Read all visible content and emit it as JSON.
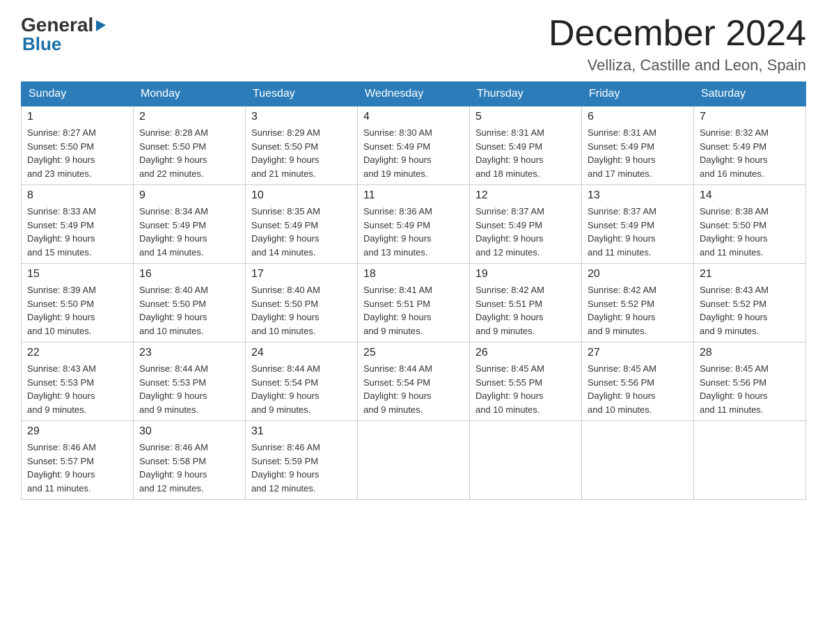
{
  "logo": {
    "general": "General",
    "blue": "Blue"
  },
  "title": "December 2024",
  "subtitle": "Velliza, Castille and Leon, Spain",
  "weekdays": [
    "Sunday",
    "Monday",
    "Tuesday",
    "Wednesday",
    "Thursday",
    "Friday",
    "Saturday"
  ],
  "weeks": [
    [
      {
        "day": "1",
        "sunrise": "8:27 AM",
        "sunset": "5:50 PM",
        "daylight": "9 hours and 23 minutes."
      },
      {
        "day": "2",
        "sunrise": "8:28 AM",
        "sunset": "5:50 PM",
        "daylight": "9 hours and 22 minutes."
      },
      {
        "day": "3",
        "sunrise": "8:29 AM",
        "sunset": "5:50 PM",
        "daylight": "9 hours and 21 minutes."
      },
      {
        "day": "4",
        "sunrise": "8:30 AM",
        "sunset": "5:49 PM",
        "daylight": "9 hours and 19 minutes."
      },
      {
        "day": "5",
        "sunrise": "8:31 AM",
        "sunset": "5:49 PM",
        "daylight": "9 hours and 18 minutes."
      },
      {
        "day": "6",
        "sunrise": "8:31 AM",
        "sunset": "5:49 PM",
        "daylight": "9 hours and 17 minutes."
      },
      {
        "day": "7",
        "sunrise": "8:32 AM",
        "sunset": "5:49 PM",
        "daylight": "9 hours and 16 minutes."
      }
    ],
    [
      {
        "day": "8",
        "sunrise": "8:33 AM",
        "sunset": "5:49 PM",
        "daylight": "9 hours and 15 minutes."
      },
      {
        "day": "9",
        "sunrise": "8:34 AM",
        "sunset": "5:49 PM",
        "daylight": "9 hours and 14 minutes."
      },
      {
        "day": "10",
        "sunrise": "8:35 AM",
        "sunset": "5:49 PM",
        "daylight": "9 hours and 14 minutes."
      },
      {
        "day": "11",
        "sunrise": "8:36 AM",
        "sunset": "5:49 PM",
        "daylight": "9 hours and 13 minutes."
      },
      {
        "day": "12",
        "sunrise": "8:37 AM",
        "sunset": "5:49 PM",
        "daylight": "9 hours and 12 minutes."
      },
      {
        "day": "13",
        "sunrise": "8:37 AM",
        "sunset": "5:49 PM",
        "daylight": "9 hours and 11 minutes."
      },
      {
        "day": "14",
        "sunrise": "8:38 AM",
        "sunset": "5:50 PM",
        "daylight": "9 hours and 11 minutes."
      }
    ],
    [
      {
        "day": "15",
        "sunrise": "8:39 AM",
        "sunset": "5:50 PM",
        "daylight": "9 hours and 10 minutes."
      },
      {
        "day": "16",
        "sunrise": "8:40 AM",
        "sunset": "5:50 PM",
        "daylight": "9 hours and 10 minutes."
      },
      {
        "day": "17",
        "sunrise": "8:40 AM",
        "sunset": "5:50 PM",
        "daylight": "9 hours and 10 minutes."
      },
      {
        "day": "18",
        "sunrise": "8:41 AM",
        "sunset": "5:51 PM",
        "daylight": "9 hours and 9 minutes."
      },
      {
        "day": "19",
        "sunrise": "8:42 AM",
        "sunset": "5:51 PM",
        "daylight": "9 hours and 9 minutes."
      },
      {
        "day": "20",
        "sunrise": "8:42 AM",
        "sunset": "5:52 PM",
        "daylight": "9 hours and 9 minutes."
      },
      {
        "day": "21",
        "sunrise": "8:43 AM",
        "sunset": "5:52 PM",
        "daylight": "9 hours and 9 minutes."
      }
    ],
    [
      {
        "day": "22",
        "sunrise": "8:43 AM",
        "sunset": "5:53 PM",
        "daylight": "9 hours and 9 minutes."
      },
      {
        "day": "23",
        "sunrise": "8:44 AM",
        "sunset": "5:53 PM",
        "daylight": "9 hours and 9 minutes."
      },
      {
        "day": "24",
        "sunrise": "8:44 AM",
        "sunset": "5:54 PM",
        "daylight": "9 hours and 9 minutes."
      },
      {
        "day": "25",
        "sunrise": "8:44 AM",
        "sunset": "5:54 PM",
        "daylight": "9 hours and 9 minutes."
      },
      {
        "day": "26",
        "sunrise": "8:45 AM",
        "sunset": "5:55 PM",
        "daylight": "9 hours and 10 minutes."
      },
      {
        "day": "27",
        "sunrise": "8:45 AM",
        "sunset": "5:56 PM",
        "daylight": "9 hours and 10 minutes."
      },
      {
        "day": "28",
        "sunrise": "8:45 AM",
        "sunset": "5:56 PM",
        "daylight": "9 hours and 11 minutes."
      }
    ],
    [
      {
        "day": "29",
        "sunrise": "8:46 AM",
        "sunset": "5:57 PM",
        "daylight": "9 hours and 11 minutes."
      },
      {
        "day": "30",
        "sunrise": "8:46 AM",
        "sunset": "5:58 PM",
        "daylight": "9 hours and 12 minutes."
      },
      {
        "day": "31",
        "sunrise": "8:46 AM",
        "sunset": "5:59 PM",
        "daylight": "9 hours and 12 minutes."
      },
      null,
      null,
      null,
      null
    ]
  ],
  "labels": {
    "sunrise": "Sunrise:",
    "sunset": "Sunset:",
    "daylight": "Daylight:"
  }
}
